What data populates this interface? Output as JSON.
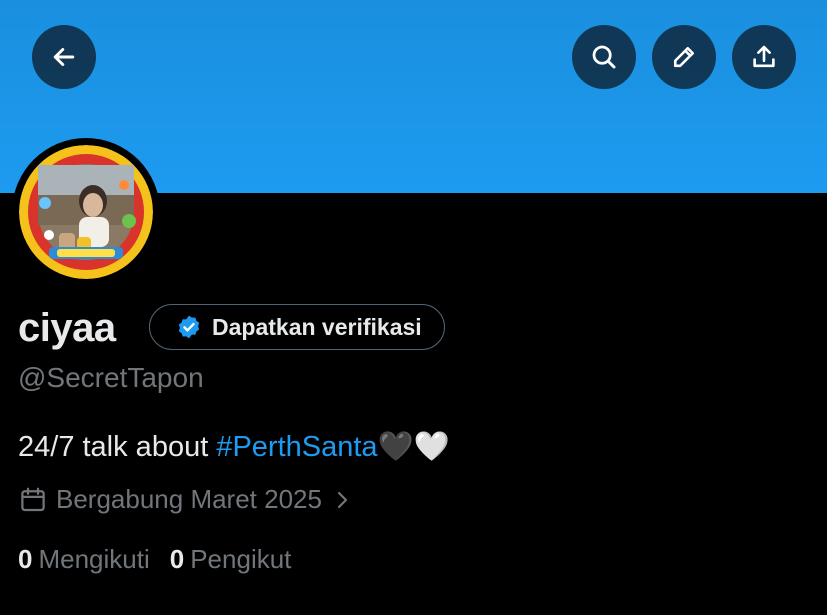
{
  "header": {
    "back_icon": "arrow-left-icon",
    "search_icon": "search-icon",
    "edit_icon": "pencil-icon",
    "share_icon": "share-upload-icon"
  },
  "profile": {
    "display_name": "ciyaa",
    "verify_label": "Dapatkan verifikasi",
    "handle": "@SecretTapon",
    "bio_text": "24/7 talk about ",
    "bio_hashtag": "#PerthSanta",
    "bio_emoji": "🖤🤍",
    "joined": "Bergabung Maret 2025",
    "following_count": "0",
    "following_label": "Mengikuti",
    "followers_count": "0",
    "followers_label": "Pengikut"
  },
  "colors": {
    "banner": "#1d9bf0",
    "background": "#000000",
    "accent": "#1d9bf0",
    "muted": "#71767b"
  }
}
